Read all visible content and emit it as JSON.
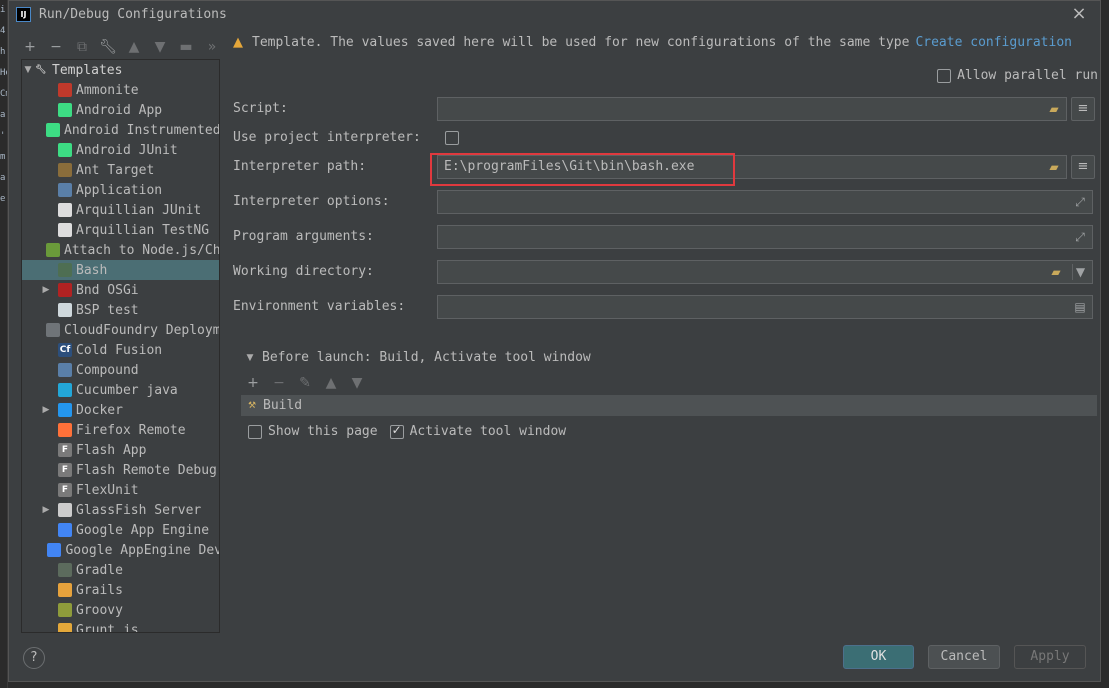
{
  "window": {
    "title": "Run/Debug Configurations",
    "app_icon": "IJ"
  },
  "background_strip": [
    "i",
    "4.",
    "h",
    "He",
    "Cm",
    "a",
    "'",
    "m",
    "a",
    "e."
  ],
  "left_toolbar": {
    "icons": [
      "add-icon",
      "remove-icon",
      "copy-icon",
      "wrench-icon",
      "move-up-icon",
      "move-down-icon",
      "folder-icon",
      "more-icon"
    ]
  },
  "tree": {
    "root_label": "Templates",
    "items": [
      {
        "label": "Ammonite",
        "icon": "ammonite-icon",
        "expandable": false
      },
      {
        "label": "Android App",
        "icon": "android-icon",
        "expandable": false
      },
      {
        "label": "Android Instrumented Tests",
        "icon": "android-test-icon",
        "expandable": false
      },
      {
        "label": "Android JUnit",
        "icon": "android-junit-icon",
        "expandable": false
      },
      {
        "label": "Ant Target",
        "icon": "ant-icon",
        "expandable": false
      },
      {
        "label": "Application",
        "icon": "application-icon",
        "expandable": false
      },
      {
        "label": "Arquillian JUnit",
        "icon": "arquillian-icon",
        "expandable": false
      },
      {
        "label": "Arquillian TestNG",
        "icon": "arquillian-icon",
        "expandable": false
      },
      {
        "label": "Attach to Node.js/Chrome",
        "icon": "nodejs-icon",
        "expandable": false
      },
      {
        "label": "Bash",
        "icon": "bash-icon",
        "expandable": false,
        "selected": true
      },
      {
        "label": "Bnd OSGi",
        "icon": "osgi-icon",
        "expandable": true
      },
      {
        "label": "BSP test",
        "icon": "bsp-icon",
        "expandable": false
      },
      {
        "label": "CloudFoundry Deployment",
        "icon": "cloudfoundry-icon",
        "expandable": false
      },
      {
        "label": "Cold Fusion",
        "icon": "coldfusion-icon",
        "expandable": false
      },
      {
        "label": "Compound",
        "icon": "compound-icon",
        "expandable": false
      },
      {
        "label": "Cucumber java",
        "icon": "cucumber-icon",
        "expandable": false
      },
      {
        "label": "Docker",
        "icon": "docker-icon",
        "expandable": true
      },
      {
        "label": "Firefox Remote",
        "icon": "firefox-icon",
        "expandable": false
      },
      {
        "label": "Flash App",
        "icon": "flash-icon",
        "expandable": false
      },
      {
        "label": "Flash Remote Debug",
        "icon": "flash-debug-icon",
        "expandable": false
      },
      {
        "label": "FlexUnit",
        "icon": "flexunit-icon",
        "expandable": false
      },
      {
        "label": "GlassFish Server",
        "icon": "glassfish-icon",
        "expandable": true
      },
      {
        "label": "Google App Engine",
        "icon": "appengine-icon",
        "expandable": false
      },
      {
        "label": "Google AppEngine Dev",
        "icon": "appengine-icon",
        "expandable": false
      },
      {
        "label": "Gradle",
        "icon": "gradle-icon",
        "expandable": false
      },
      {
        "label": "Grails",
        "icon": "grails-icon",
        "expandable": false
      },
      {
        "label": "Groovy",
        "icon": "groovy-icon",
        "expandable": false
      },
      {
        "label": "Grunt.js",
        "icon": "grunt-icon",
        "expandable": false
      }
    ]
  },
  "warning": {
    "text": "Template. The values saved here will be used for new configurations of the same type",
    "link": "Create configuration"
  },
  "allow_parallel": {
    "label": "Allow parallel run",
    "checked": false
  },
  "form": {
    "script": {
      "label": "Script:",
      "value": ""
    },
    "use_project_interpreter": {
      "label": "Use project interpreter:",
      "checked": false
    },
    "interpreter_path": {
      "label": "Interpreter path:",
      "value": "E:\\programFiles\\Git\\bin\\bash.exe"
    },
    "interpreter_options": {
      "label": "Interpreter options:",
      "value": ""
    },
    "program_arguments": {
      "label": "Program arguments:",
      "value": ""
    },
    "working_directory": {
      "label": "Working directory:",
      "value": ""
    },
    "environment_variables": {
      "label": "Environment variables:",
      "value": ""
    }
  },
  "before_launch": {
    "label": "Before launch: Build, Activate tool window",
    "tasks": [
      "Build"
    ],
    "show_page": {
      "label": "Show this page",
      "checked": false
    },
    "activate_tool_window": {
      "label": "Activate tool window",
      "checked": true
    }
  },
  "buttons": {
    "ok": "OK",
    "cancel": "Cancel",
    "apply": "Apply",
    "help": "?"
  },
  "colors": {
    "accent": "#3b6e74",
    "selection": "#4b6e74",
    "link": "#5a9ccf",
    "highlight_box": "#e0393e",
    "warning": "#e5a73a"
  }
}
